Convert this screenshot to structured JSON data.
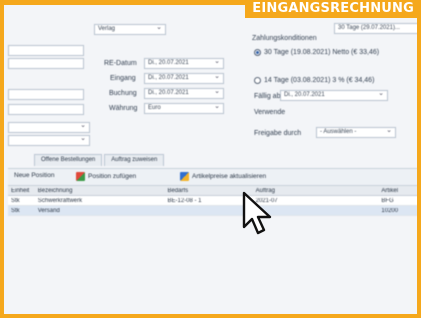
{
  "banner": {
    "text": "EINGANGSRECHNUNG"
  },
  "top_select": {
    "value": "Verlag"
  },
  "top_right_field": {
    "value": "30 Tage (29.07.2021)..."
  },
  "zahlungskonditionen": {
    "label": "Zahlungskonditionen"
  },
  "dates": {
    "re_datum": {
      "label": "RE-Datum",
      "value": "Di., 20.07.2021"
    },
    "eingang": {
      "label": "Eingang",
      "value": "Di., 20.07.2021"
    },
    "buchung": {
      "label": "Buchung",
      "value": "Di., 20.07.2021"
    },
    "waehrung": {
      "label": "Währung",
      "value": "Euro"
    }
  },
  "payment_options": [
    {
      "label": "30 Tage (19.08.2021) Netto (€ 33,46)",
      "selected": true
    },
    {
      "label": "14 Tage (03.08.2021) 3 % (€ 34,46)",
      "selected": false
    }
  ],
  "faellig_ab": {
    "label": "Fällig ab",
    "value": "Di., 20.07.2021"
  },
  "verwenden": {
    "label": "Verwende"
  },
  "freigabe": {
    "label": "Freigabe durch",
    "value": "- Auswählen -"
  },
  "left_fields": [
    {
      "value": ""
    },
    {
      "value": ""
    },
    {
      "value": ""
    },
    {
      "value": ""
    },
    {
      "value": ""
    },
    {
      "value": ""
    }
  ],
  "tabs": [
    "Offene Bestellungen",
    "Auftrag zuweisen"
  ],
  "toolbar": {
    "new_position": "Neue Position",
    "add_position": "Position zufügen",
    "price_update": "Artikelpreise aktualisieren",
    "icon_colors": [
      "#e0483a",
      "#3c9a47",
      "#2f6fd0",
      "#f2b32a"
    ]
  },
  "table": {
    "headers": [
      "Einheit",
      "Bezeichnung",
      "Bedarfs",
      "Auftrag",
      "Artikel"
    ],
    "rows": [
      [
        "Stk",
        "Schwerkraftwerk",
        "BE-12-08 - 1",
        "2021-07",
        "BFG"
      ],
      [
        "Stk",
        "Versand",
        "",
        "",
        "10200"
      ]
    ]
  }
}
